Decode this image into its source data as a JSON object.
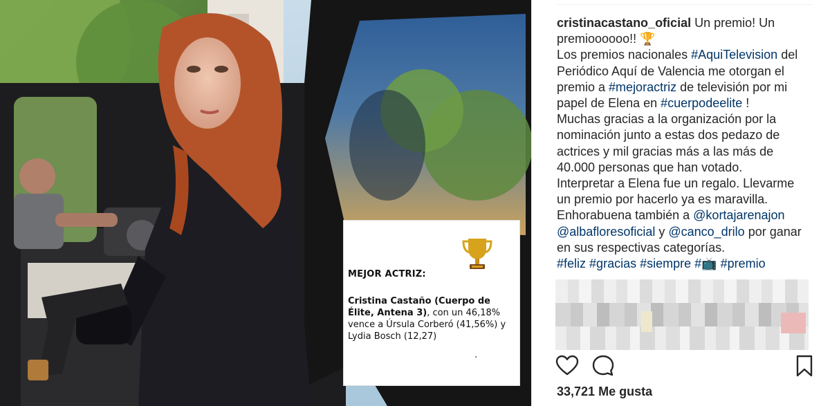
{
  "post": {
    "username": "cristinacastano_oficial",
    "caption_lines": [
      [
        {
          "t": "user",
          "v": "cristinacastano_oficial"
        },
        {
          "t": "text",
          "v": " Un premio! Un"
        }
      ],
      [
        {
          "t": "text",
          "v": "premioooooo!! 🏆"
        }
      ],
      [
        {
          "t": "text",
          "v": "Los premios nacionales "
        },
        {
          "t": "tag",
          "v": "#AquiTelevision"
        },
        {
          "t": "text",
          "v": " del"
        }
      ],
      [
        {
          "t": "text",
          "v": "Periódico Aquí de Valencia me otorgan el"
        }
      ],
      [
        {
          "t": "text",
          "v": "premio a "
        },
        {
          "t": "tag",
          "v": "#mejoractriz"
        },
        {
          "t": "text",
          "v": " de televisión por mi"
        }
      ],
      [
        {
          "t": "text",
          "v": "papel de Elena en "
        },
        {
          "t": "tag",
          "v": "#cuerpodeelite"
        },
        {
          "t": "text",
          "v": " !"
        }
      ],
      [
        {
          "t": "text",
          "v": "Muchas gracias a la organización por la"
        }
      ],
      [
        {
          "t": "text",
          "v": "nominación junto a estas dos pedazo de"
        }
      ],
      [
        {
          "t": "text",
          "v": "actrices y mil gracias más a las más de"
        }
      ],
      [
        {
          "t": "text",
          "v": "40.000 personas que han votado."
        }
      ],
      [
        {
          "t": "text",
          "v": "Interpretar a Elena fue un regalo. Llevarme"
        }
      ],
      [
        {
          "t": "text",
          "v": "un premio por hacerlo ya es maravilla."
        }
      ],
      [
        {
          "t": "text",
          "v": "Enhorabuena también a "
        },
        {
          "t": "tag",
          "v": "@kortajarenajon"
        }
      ],
      [
        {
          "t": "tag",
          "v": "@albafloresoficial"
        },
        {
          "t": "text",
          "v": " y "
        },
        {
          "t": "tag",
          "v": "@canco_drilo"
        },
        {
          "t": "text",
          "v": " por ganar"
        }
      ],
      [
        {
          "t": "text",
          "v": "en sus respectivas categorías."
        }
      ],
      [
        {
          "t": "tag",
          "v": "#feliz"
        },
        {
          "t": "text",
          "v": " "
        },
        {
          "t": "tag",
          "v": "#gracias"
        },
        {
          "t": "text",
          "v": " "
        },
        {
          "t": "tag",
          "v": "#siempre"
        },
        {
          "t": "text",
          "v": " "
        },
        {
          "t": "tag",
          "v": "#📺"
        },
        {
          "t": "text",
          "v": "  "
        },
        {
          "t": "tag",
          "v": "#premio"
        }
      ]
    ],
    "likes_count": "33,721",
    "likes_label": "Me gusta",
    "likes_text": "33,721 Me gusta"
  },
  "image_card": {
    "title": "MEJOR ACTRIZ:",
    "winner": "Cristina Castaño (Cuerpo de Élite, Antena 3)",
    "result_text": ", con un 46,18% vence a Úrsula Corberó (41,56%) y Lydia Bosch (12,27)"
  },
  "icons": {
    "like": "heart-icon",
    "comment": "comment-icon",
    "save": "bookmark-icon",
    "award": "trophy-icon"
  },
  "colors": {
    "text": "#262626",
    "link": "#003569",
    "trophy_gold": "#d7a21c",
    "border": "#efefef"
  }
}
